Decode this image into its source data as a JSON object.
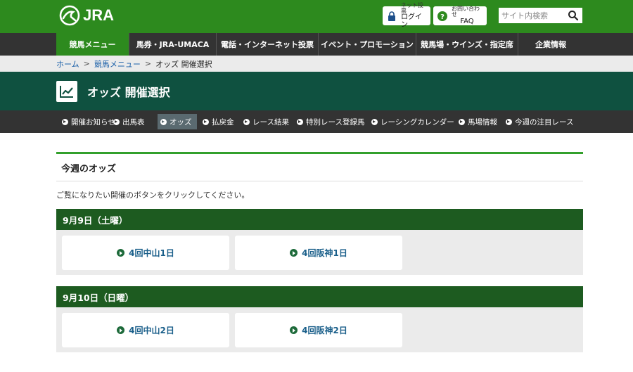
{
  "header": {
    "logo_text": "JRA",
    "login_top": "ネット投票",
    "login_bottom": "ログイン",
    "faq_top": "お問い合わせ",
    "faq_bottom": "FAQ",
    "search_placeholder": "サイト内検索",
    "brand_color": "#2d8a1e"
  },
  "global_nav": [
    {
      "label": "競馬メニュー",
      "active": true
    },
    {
      "label": "馬券・JRA-UMACA",
      "active": false
    },
    {
      "label": "電話・インターネット投票",
      "active": false
    },
    {
      "label": "イベント・プロモーション",
      "active": false
    },
    {
      "label": "競馬場・ウインズ・指定席",
      "active": false
    },
    {
      "label": "企業情報",
      "active": false
    }
  ],
  "breadcrumb": {
    "home": "ホーム",
    "parent": "競馬メニュー",
    "separator": ">",
    "current": "オッズ 開催選択"
  },
  "page": {
    "title": "オッズ 開催選択",
    "icon": "chart-line-icon"
  },
  "local_nav": [
    {
      "label": "開催お知らせ",
      "active": false
    },
    {
      "label": "出馬表",
      "active": false
    },
    {
      "label": "オッズ",
      "active": true
    },
    {
      "label": "払戻金",
      "active": false
    },
    {
      "label": "レース結果",
      "active": false
    },
    {
      "label": "特別レース登録馬",
      "active": false
    },
    {
      "label": "レーシングカレンダー",
      "active": false
    },
    {
      "label": "馬場情報",
      "active": false
    },
    {
      "label": "今週の注目レース",
      "active": false
    }
  ],
  "main": {
    "section_title": "今週のオッズ",
    "intro": "ご覧になりたい開催のボタンをクリックしてください。",
    "days": [
      {
        "label": "9月9日（土曜）",
        "meetings": [
          "4回中山1日",
          "4回阪神1日"
        ]
      },
      {
        "label": "9月10日（日曜）",
        "meetings": [
          "4回中山2日",
          "4回阪神2日"
        ]
      }
    ]
  }
}
